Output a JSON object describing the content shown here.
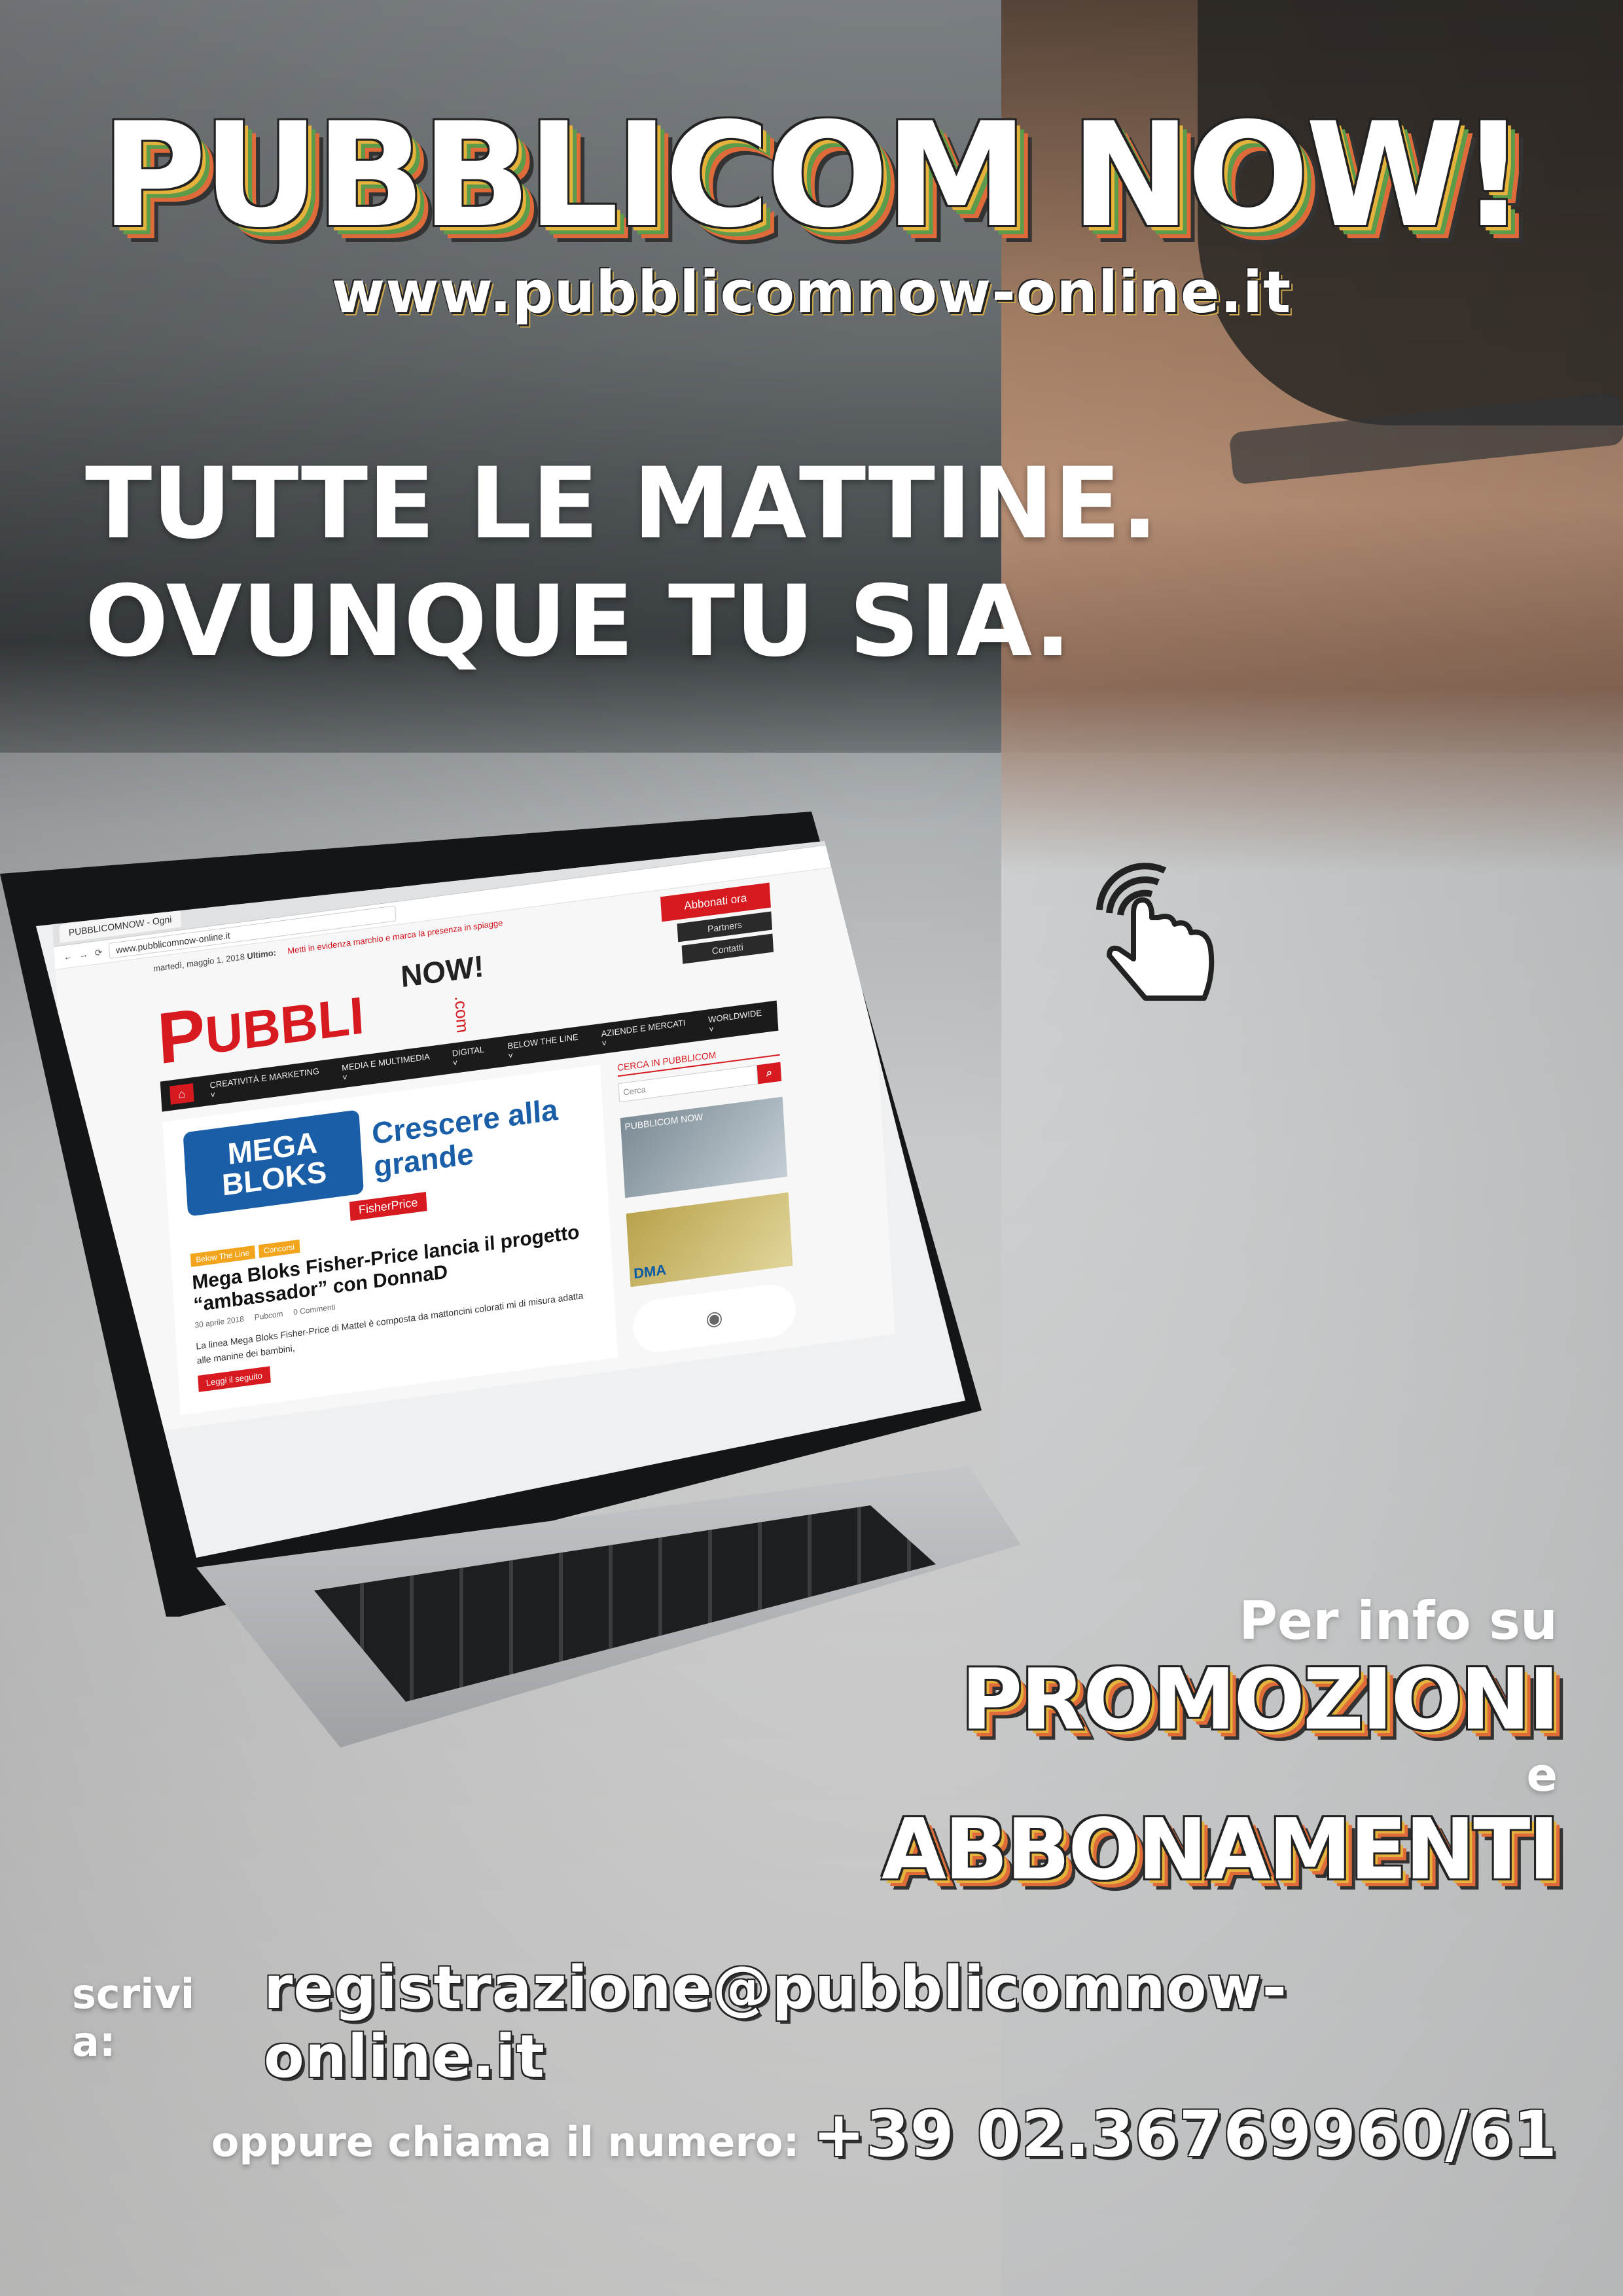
{
  "brand": {
    "title": "PUBBLICOM NOW!",
    "url": "www.pubblicomnow-online.it"
  },
  "tagline": {
    "line1": "TUTTE LE MATTINE.",
    "line2": "OVUNQUE TU SIA."
  },
  "screen": {
    "browser_tab": "PUBBLICOMNOW - Ogni",
    "address": "www.pubblicomnow-online.it",
    "date": "martedì, maggio 1, 2018",
    "breaking_label": "Ultimo:",
    "breaking_text": "Metti in evidenza marchio e marca la presenza in spiagge",
    "subscribe": "Abbonati ora",
    "partners": "Partners",
    "contacts": "Contatti",
    "logo": {
      "now": "NOW!",
      "p": "P",
      "rest": "UBBLI",
      "com": ".com"
    },
    "nav": [
      "CREATIVITÀ E MARKETING ˅",
      "MEDIA E MULTIMEDIA ˅",
      "DIGITAL ˅",
      "BELOW THE LINE ˅",
      "AZIENDE E MERCATI ˅",
      "WORLDWIDE ˅"
    ],
    "ad": {
      "box": "MEGA BLOKS",
      "slogan": "Crescere alla grande",
      "brand": "FisherPrice"
    },
    "tags": [
      "Below The Line",
      "Concorsi"
    ],
    "headline": "Mega Bloks Fisher-Price lancia il progetto “ambassador” con DonnaD",
    "meta": [
      "30 aprile 2018",
      "Pubcom",
      "0 Commenti"
    ],
    "excerpt": "La linea Mega Bloks Fisher-Price di Mattel è composta da mattoncini colorati mi di misura adatta alle manine dei bambini,",
    "readmore": "Leggi il seguito",
    "sidebar": {
      "head": "CERCA IN PUBBLICOM",
      "search_placeholder": "Cerca",
      "ad1": "PUBBLICOM NOW",
      "ad2": "DMA"
    }
  },
  "info": {
    "per": "Per info su",
    "promozioni": "PROMOZIONI",
    "e": "e",
    "abbonamenti": "ABBONAMENTI"
  },
  "contact": {
    "scrivi": "scrivi a:",
    "email": "registrazione@pubblicomnow-online.it",
    "oppure": "oppure chiama il numero:",
    "phone": "+39 02.36769960/61"
  },
  "colors": {
    "brand_red": "#d71920",
    "accent_yellow": "#e5b23b",
    "accent_green": "#5c9b4a",
    "accent_orange": "#e06b3a",
    "mega_blue": "#1a5ea8"
  },
  "icons": {
    "touch": "touch-hand-icon",
    "home": "home-icon",
    "search": "search-icon"
  }
}
